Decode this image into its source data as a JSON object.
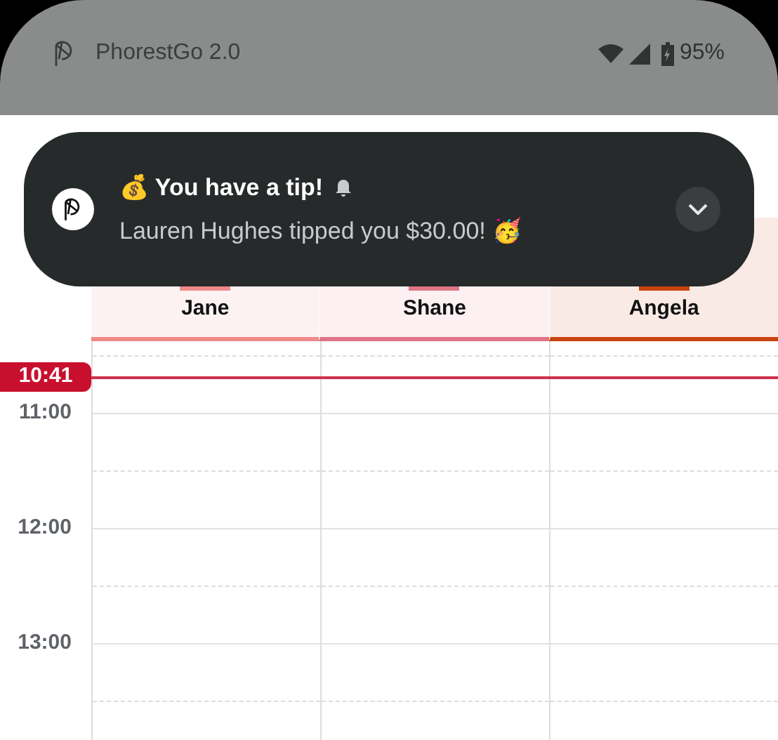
{
  "status_bar": {
    "app_name": "PhorestGo 2.0",
    "battery": "95%"
  },
  "notification": {
    "title": "💰 You have a tip!",
    "message": "Lauren Hughes tipped you $30.00! 🥳"
  },
  "staff": [
    {
      "name": "Jane",
      "color": "#f08a8a"
    },
    {
      "name": "Shane",
      "color": "#e07585"
    },
    {
      "name": "Angela",
      "color": "#c9430e"
    }
  ],
  "times": [
    "11:00",
    "12:00",
    "13:00"
  ],
  "now": {
    "time": "10:41"
  }
}
